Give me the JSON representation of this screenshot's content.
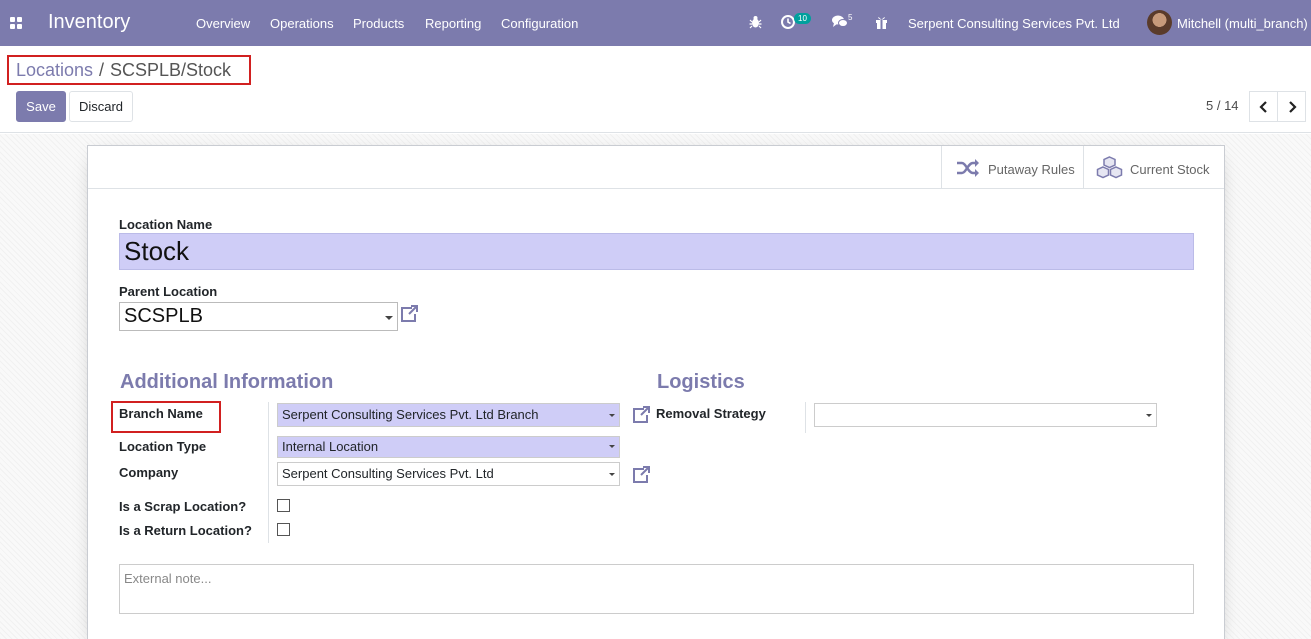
{
  "navbar": {
    "app_name": "Inventory",
    "menu": [
      "Overview",
      "Operations",
      "Products",
      "Reporting",
      "Configuration"
    ],
    "activity_count": "10",
    "message_count": "5",
    "company": "Serpent Consulting Services Pvt. Ltd",
    "user": "Mitchell (multi_branch)",
    "color": "#7c7bad"
  },
  "breadcrumb": {
    "parent": "Locations",
    "separator": "/",
    "current": "SCSPLB/Stock"
  },
  "toolbar": {
    "save_label": "Save",
    "discard_label": "Discard"
  },
  "pager": {
    "value": "5 / 14"
  },
  "smart_buttons": {
    "putaway": "Putaway Rules",
    "stock": "Current Stock"
  },
  "form": {
    "location_name_label": "Location Name",
    "location_name": "Stock",
    "parent_label": "Parent Location",
    "parent_value": "SCSPLB",
    "additional_title": "Additional Information",
    "logistics_title": "Logistics",
    "branch_label": "Branch Name",
    "branch_value": "Serpent Consulting Services Pvt. Ltd Branch",
    "type_label": "Location Type",
    "type_value": "Internal Location",
    "company_label": "Company",
    "company_value": "Serpent Consulting Services Pvt. Ltd",
    "scrap_label": "Is a Scrap Location?",
    "return_label": "Is a Return Location?",
    "removal_label": "Removal Strategy",
    "removal_value": "",
    "note_placeholder": "External note..."
  }
}
